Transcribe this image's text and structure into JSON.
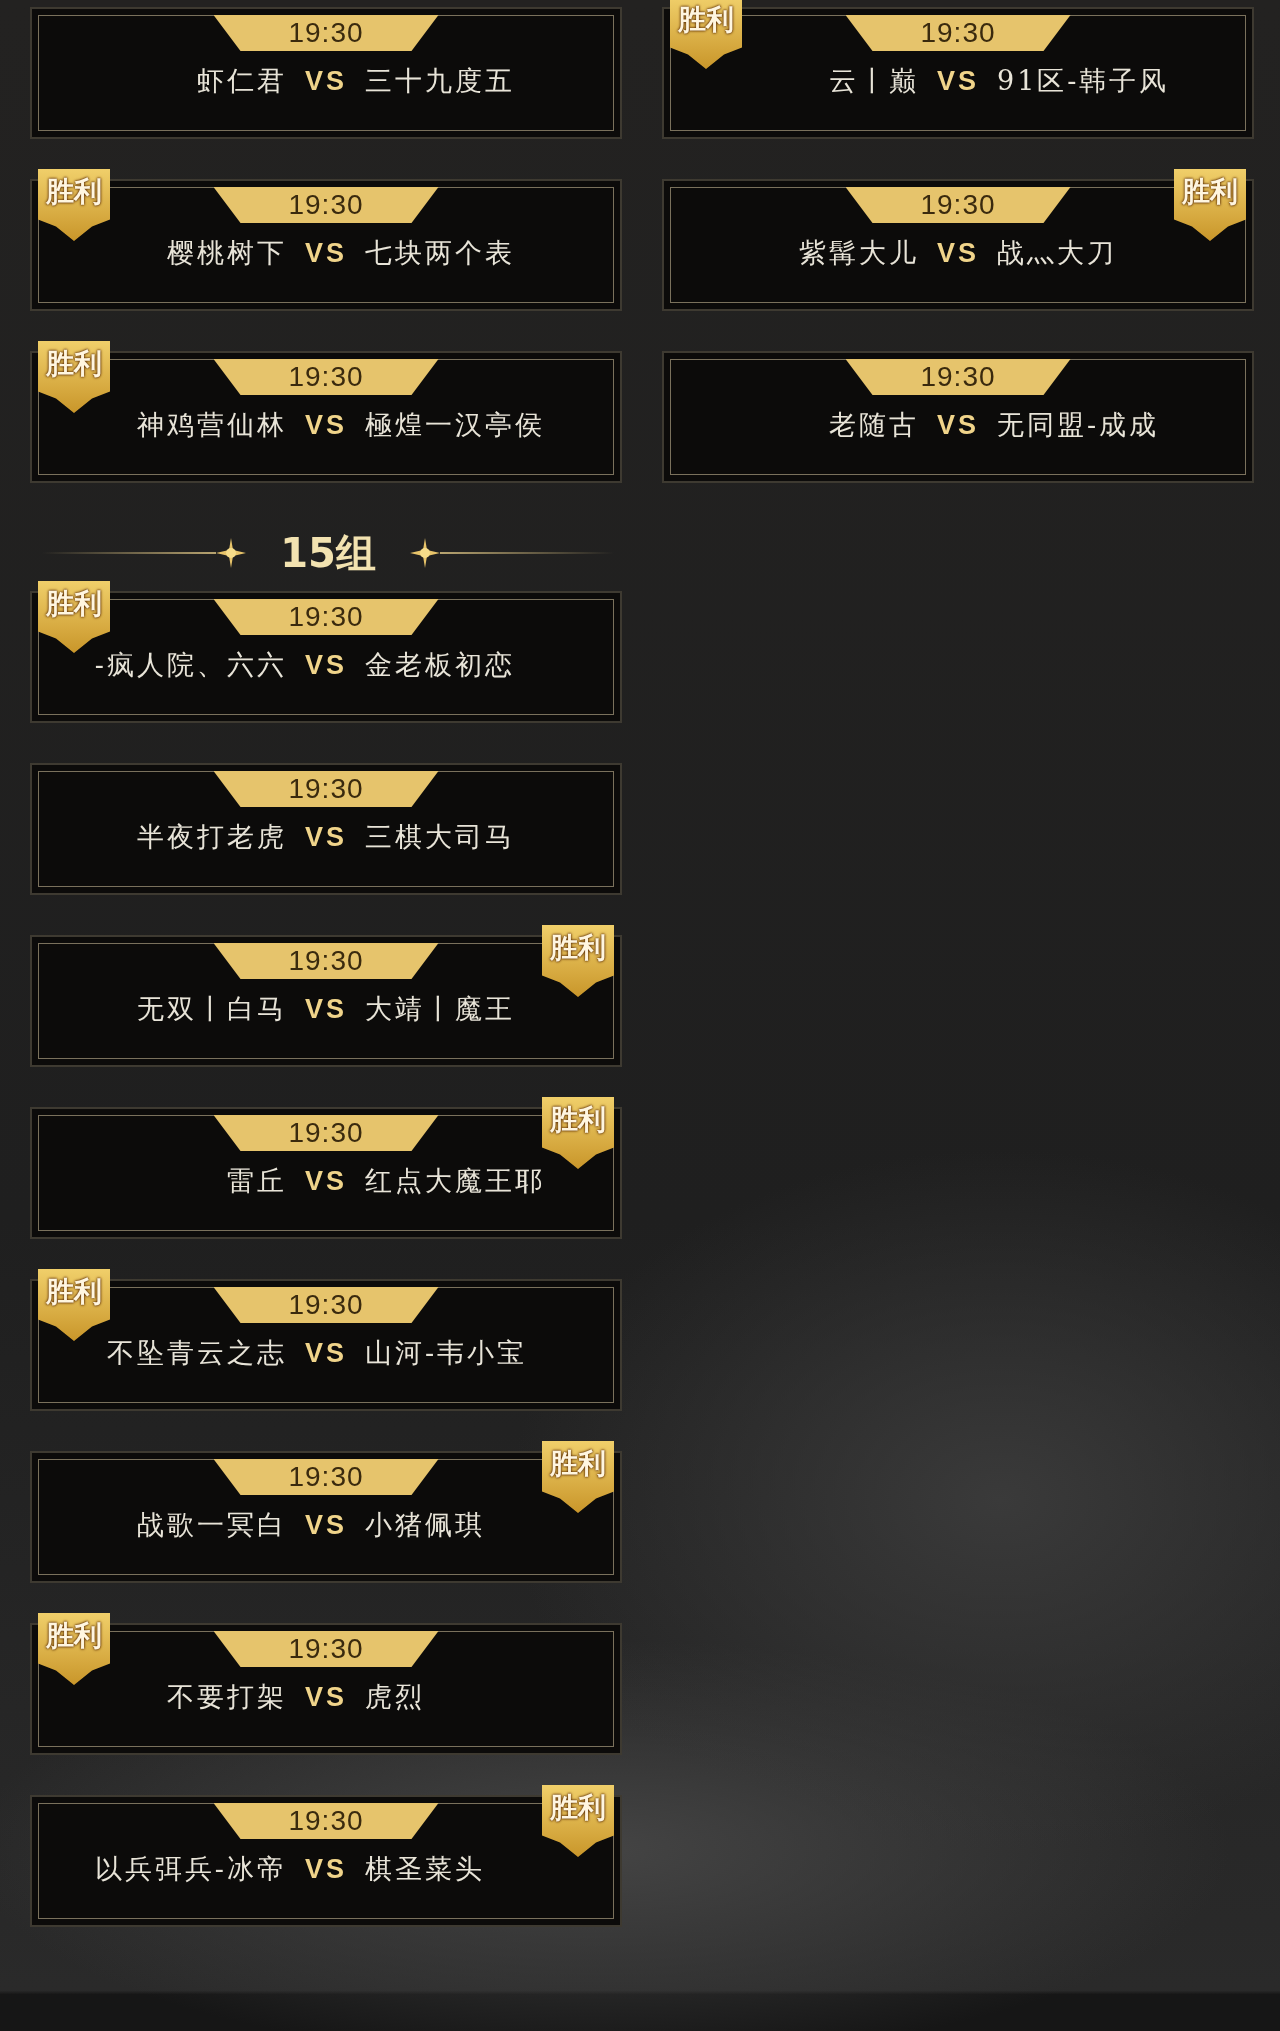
{
  "sections": [
    {
      "matches": [
        {
          "time": "19:30",
          "player1": "虾仁君",
          "vs": "VS",
          "player2": "三十九度五"
        },
        {
          "time": "19:30",
          "player1": "云丨巅",
          "vs": "VS",
          "player2": "91区-韩子风",
          "badge": {
            "text": "胜利",
            "on_left": true
          }
        },
        {
          "time": "19:30",
          "player1": "樱桃树下",
          "vs": "VS",
          "player2": "七块两个表",
          "badge": {
            "text": "胜利",
            "on_left": true
          }
        },
        {
          "time": "19:30",
          "player1": "紫髯大儿",
          "vs": "VS",
          "player2": "战灬大刀",
          "badge": {
            "text": "胜利",
            "on_left": false
          }
        },
        {
          "time": "19:30",
          "player1": "神鸡营仙林",
          "vs": "VS",
          "player2": "極煌一汉亭侯",
          "badge": {
            "text": "胜利",
            "on_left": true
          }
        },
        {
          "time": "19:30",
          "player1": "老随古",
          "vs": "VS",
          "player2": "无同盟-成成"
        }
      ]
    },
    {
      "title": "15组",
      "matches": [
        {
          "time": "19:30",
          "player1": "-疯人院、六六",
          "vs": "VS",
          "player2": "金老板初恋",
          "badge": {
            "text": "胜利",
            "on_left": true
          }
        },
        {
          "time": "19:30",
          "player1": "半夜打老虎",
          "vs": "VS",
          "player2": "三棋大司马"
        },
        {
          "time": "19:30",
          "player1": "无双丨白马",
          "vs": "VS",
          "player2": "大靖丨魔王",
          "badge": {
            "text": "胜利",
            "on_left": false
          }
        },
        {
          "time": "19:30",
          "player1": "雷丘",
          "vs": "VS",
          "player2": "红点大魔王耶",
          "badge": {
            "text": "胜利",
            "on_left": false
          }
        },
        {
          "time": "19:30",
          "player1": "不坠青云之志",
          "vs": "VS",
          "player2": "山河-韦小宝",
          "badge": {
            "text": "胜利",
            "on_left": true
          }
        },
        {
          "time": "19:30",
          "player1": "战歌一冥白",
          "vs": "VS",
          "player2": "小猪佩琪",
          "badge": {
            "text": "胜利",
            "on_left": false
          }
        },
        {
          "time": "19:30",
          "player1": "不要打架",
          "vs": "VS",
          "player2": "虎烈",
          "badge": {
            "text": "胜利",
            "on_left": true
          }
        },
        {
          "time": "19:30",
          "player1": "以兵弭兵-冰帝",
          "vs": "VS",
          "player2": "棋圣菜头",
          "badge": {
            "text": "胜利",
            "on_left": false
          }
        }
      ]
    }
  ]
}
